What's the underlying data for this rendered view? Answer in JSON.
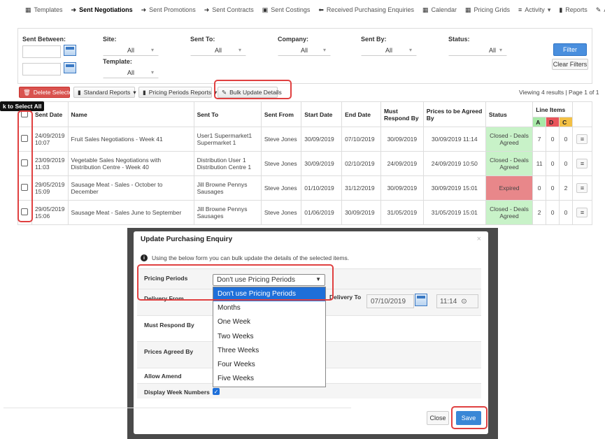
{
  "nav": {
    "items": [
      {
        "label": "Templates",
        "icon": "table-icon"
      },
      {
        "label": "Sent Negotiations",
        "icon": "arrow-right-icon"
      },
      {
        "label": "Sent Promotions",
        "icon": "arrow-right-icon"
      },
      {
        "label": "Sent Contracts",
        "icon": "arrow-right-icon"
      },
      {
        "label": "Sent Costings",
        "icon": "money-icon"
      },
      {
        "label": "Received Purchasing Enquiries",
        "icon": "arrow-left-icon"
      },
      {
        "label": "Calendar",
        "icon": "calendar-icon"
      },
      {
        "label": "Pricing Grids",
        "icon": "grid-icon"
      },
      {
        "label": "Activity",
        "icon": "list-icon"
      },
      {
        "label": "Reports",
        "icon": "file-icon"
      },
      {
        "label": "Admin",
        "icon": "wrench-icon"
      }
    ],
    "caret": "▾"
  },
  "filters": {
    "sent_between": "Sent Between:",
    "site": "Site:",
    "site_value": "All",
    "template": "Template:",
    "template_value": "All",
    "sent_to": "Sent To:",
    "sent_to_value": "All",
    "company": "Company:",
    "company_value": "All",
    "sent_by": "Sent By:",
    "sent_by_value": "All",
    "status": "Status:",
    "status_value": "All",
    "filter_btn": "Filter",
    "clear_btn": "Clear Filters"
  },
  "toolbar": {
    "delete": "Delete Selected",
    "standard_reports": "Standard Reports",
    "pricing_reports": "Pricing Periods Reports",
    "bulk_update": "Bulk Update Details",
    "viewing": "Viewing 4 results | Page 1 of 1",
    "tooltip": "k to Select All"
  },
  "table": {
    "headers": [
      "Sent Date",
      "Name",
      "Sent To",
      "Sent From",
      "Start Date",
      "End Date",
      "Must Respond By",
      "Prices to be Agreed By",
      "Status",
      "Line Items"
    ],
    "line_items_sub": [
      "A",
      "D",
      "C"
    ],
    "rows": [
      {
        "sent_date": "24/09/2019 10:07",
        "name": "Fruit Sales Negotiations - Week 41",
        "sent_to": "User1 Supermarket1 Supermarket 1",
        "sent_from": "Steve Jones",
        "start": "30/09/2019",
        "end": "07/10/2019",
        "respond": "30/09/2019",
        "prices": "30/09/2019 11:14",
        "status": "Closed - Deals Agreed",
        "status_type": "green",
        "a": "7",
        "d": "0",
        "c": "0"
      },
      {
        "sent_date": "23/09/2019 11:03",
        "name": "Vegetable Sales Negotiations with Distribution Centre - Week 40",
        "sent_to": "Distribution User 1 Distribution Centre 1",
        "sent_from": "Steve Jones",
        "start": "30/09/2019",
        "end": "02/10/2019",
        "respond": "24/09/2019",
        "prices": "24/09/2019 10:50",
        "status": "Closed - Deals Agreed",
        "status_type": "green",
        "a": "11",
        "d": "0",
        "c": "0"
      },
      {
        "sent_date": "29/05/2019 15:09",
        "name": "Sausage Meat - Sales - October to December",
        "sent_to": "Jill Browne Pennys Sausages",
        "sent_from": "Steve Jones",
        "start": "01/10/2019",
        "end": "31/12/2019",
        "respond": "30/09/2019",
        "prices": "30/09/2019 15:01",
        "status": "Expired",
        "status_type": "red",
        "a": "0",
        "d": "0",
        "c": "2"
      },
      {
        "sent_date": "29/05/2019 15:06",
        "name": "Sausage Meat - Sales June to September",
        "sent_to": "Jill Browne Pennys Sausages",
        "sent_from": "Steve Jones",
        "start": "01/06/2019",
        "end": "30/09/2019",
        "respond": "31/05/2019",
        "prices": "31/05/2019 15:01",
        "status": "Closed - Deals Agreed",
        "status_type": "green",
        "a": "2",
        "d": "0",
        "c": "0"
      }
    ]
  },
  "modal": {
    "title": "Update Purchasing Enquiry",
    "close": "×",
    "info": "Using the below form you can bulk update the details of the selected items.",
    "pricing_periods": "Pricing Periods",
    "pricing_value": "Don't use Pricing Periods",
    "delivery_from": "Delivery From",
    "delivery_to": "Delivery To",
    "delivery_to_date": "07/10/2019",
    "delivery_to_time": "11:14",
    "must_respond": "Must Respond By",
    "prices_agreed": "Prices Agreed By",
    "allow_amend": "Allow Amend",
    "display_week": "Display Week Numbers",
    "options": [
      "Don't use Pricing Periods",
      "Months",
      "One Week",
      "Two Weeks",
      "Three Weeks",
      "Four Weeks",
      "Five Weeks"
    ],
    "close_btn": "Close",
    "save_btn": "Save"
  },
  "colors": {
    "accent": "#3a87d6",
    "highlight": "#e04040",
    "green": "#c8f2c8",
    "red": "#e8878a"
  }
}
